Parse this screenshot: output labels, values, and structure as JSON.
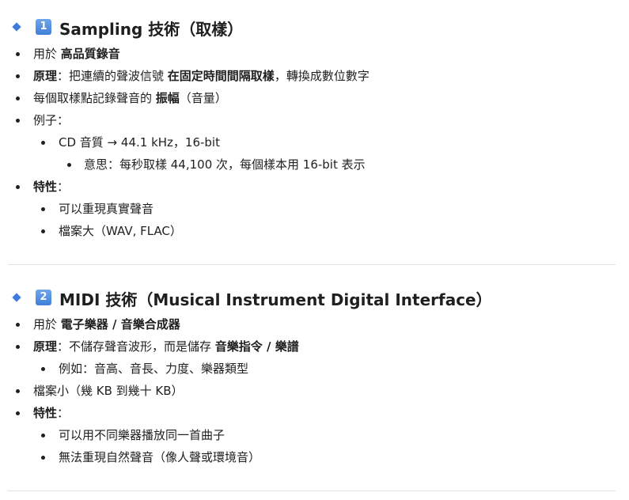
{
  "sections": [
    {
      "number": "1",
      "title": "Sampling 技術（取樣）",
      "items": [
        {
          "p1": "用於 ",
          "b1": "高品質錄音"
        },
        {
          "b1": "原理",
          "p1": "：把連續的聲波信號 ",
          "b2": "在固定時間間隔取樣",
          "p2": "，轉換成數位數字"
        },
        {
          "p1": "每個取樣點記錄聲音的 ",
          "b1": "振幅",
          "p2": "（音量）"
        },
        {
          "p1": "例子："
        },
        {
          "p1": "CD 音質 → 44.1 kHz，16-bit"
        },
        {
          "p1": "意思：每秒取樣 44,100 次，每個樣本用 16-bit 表示"
        },
        {
          "b1": "特性",
          "p1": "："
        },
        {
          "p1": "可以重現真實聲音"
        },
        {
          "p1": "檔案大（WAV, FLAC）"
        }
      ]
    },
    {
      "number": "2",
      "title": "MIDI 技術（Musical Instrument Digital Interface）",
      "items": [
        {
          "p1": "用於 ",
          "b1": "電子樂器 / 音樂合成器"
        },
        {
          "b1": "原理",
          "p1": "：不儲存聲音波形，而是儲存 ",
          "b2": "音樂指令 / 樂譜"
        },
        {
          "p1": "例如：音高、音長、力度、樂器類型"
        },
        {
          "p1": "檔案小（幾 KB 到幾十 KB）"
        },
        {
          "b1": "特性",
          "p1": "："
        },
        {
          "p1": "可以用不同樂器播放同一首曲子"
        },
        {
          "p1": "無法重現自然聲音（像人聲或環境音）"
        }
      ]
    }
  ],
  "colors": {
    "accent": "#3d7bd9",
    "text": "#1f1f1f",
    "divider": "#e1e1e1"
  }
}
